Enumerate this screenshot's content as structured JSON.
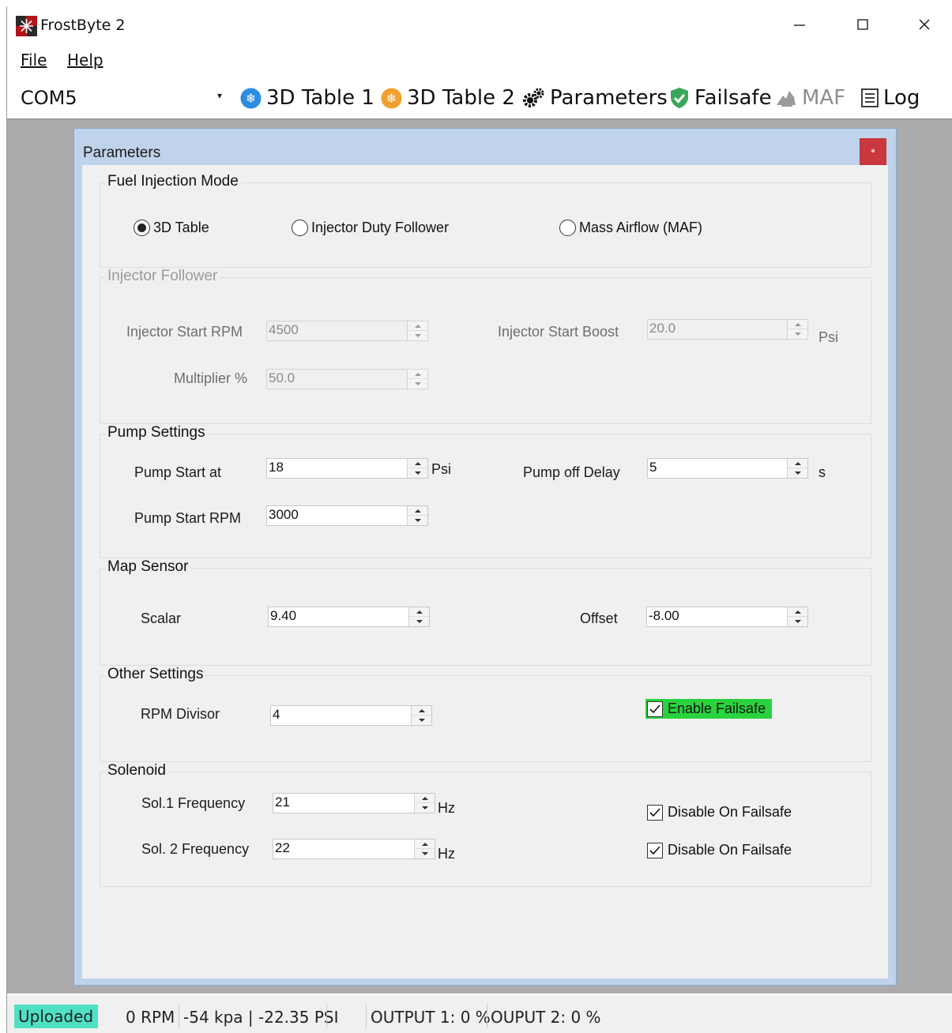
{
  "window": {
    "title": "FrostByte 2"
  },
  "menu": {
    "file": "File",
    "help": "Help"
  },
  "toolbar": {
    "port": "COM5",
    "table1": "3D Table 1",
    "table2": "3D Table 2",
    "parameters": "Parameters",
    "failsafe": "Failsafe",
    "maf": "MAF",
    "log": "Log"
  },
  "child": {
    "title": "Parameters",
    "fuel": {
      "label": "Fuel Injection Mode",
      "options": [
        "3D Table",
        "Injector Duty Follower",
        "Mass Airflow (MAF)"
      ],
      "selected": "3D Table"
    },
    "injector": {
      "label": "Injector Follower",
      "start_rpm_label": "Injector Start RPM",
      "start_rpm": "4500",
      "start_boost_label": "Injector Start Boost",
      "start_boost": "20.0",
      "boost_unit": "Psi",
      "multiplier_label": "Multiplier %",
      "multiplier": "50.0"
    },
    "pump": {
      "label": "Pump Settings",
      "start_at_label": "Pump Start at",
      "start_at": "18",
      "start_at_unit": "Psi",
      "off_delay_label": "Pump off Delay",
      "off_delay": "5",
      "off_delay_unit": "s",
      "start_rpm_label": "Pump Start RPM",
      "start_rpm": "3000"
    },
    "map": {
      "label": "Map Sensor",
      "scalar_label": "Scalar",
      "scalar": "9.40",
      "offset_label": "Offset",
      "offset": "-8.00"
    },
    "other": {
      "label": "Other Settings",
      "rpm_divisor_label": "RPM Divisor",
      "rpm_divisor": "4",
      "enable_failsafe": "Enable Failsafe",
      "enable_failsafe_checked": true
    },
    "solenoid": {
      "label": "Solenoid",
      "sol1_label": "Sol.1 Frequency",
      "sol1": "21",
      "sol1_unit": "Hz",
      "sol2_label": "Sol. 2 Frequency",
      "sol2": "22",
      "sol2_unit": "Hz",
      "disable1": "Disable On Failsafe",
      "disable2": "Disable On Failsafe"
    }
  },
  "status": {
    "state": "Uploaded",
    "rpm": "0 RPM",
    "pressure": "-54 kpa | -22.35 PSI",
    "output1": "OUTPUT 1: 0 %",
    "output2": "OUPUT 2: 0 %"
  },
  "colors": {
    "uploaded": "#4fe0c4",
    "failsafe_highlight": "#29d33e",
    "close_button": "#c8383c",
    "child_frame": "#bfd3ea"
  }
}
